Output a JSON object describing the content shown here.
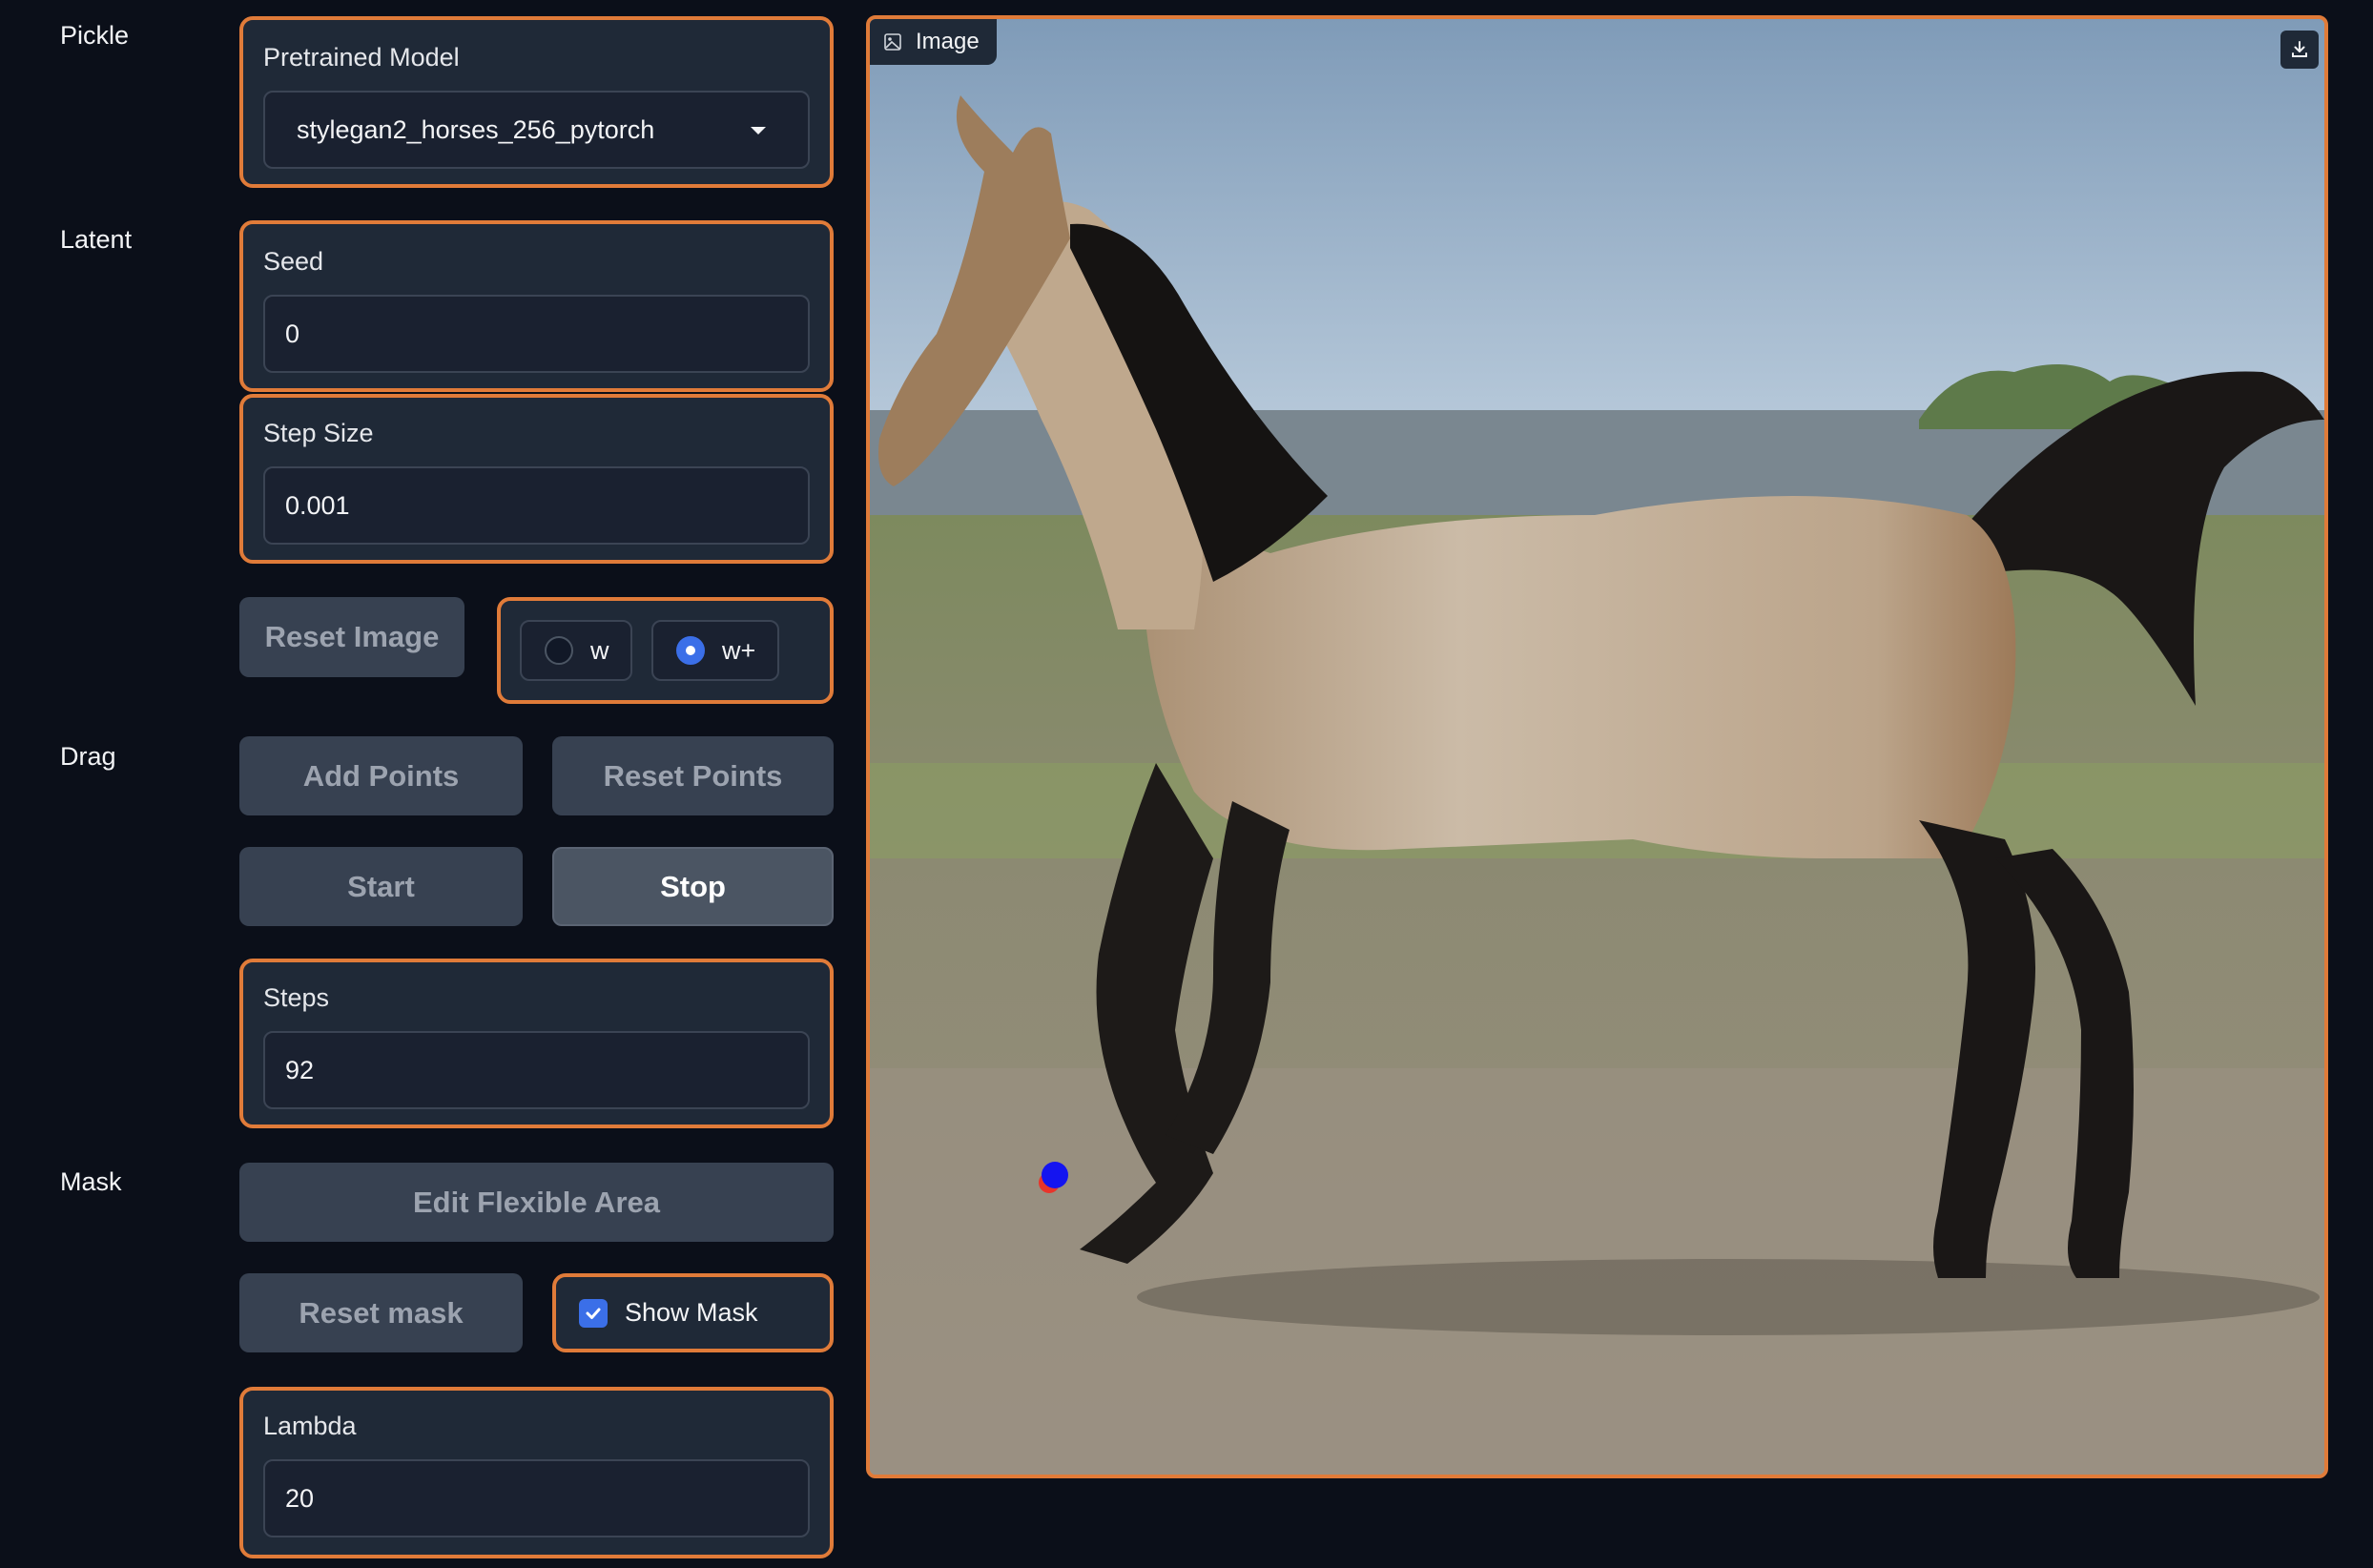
{
  "sections": {
    "pickle": "Pickle",
    "latent": "Latent",
    "drag": "Drag",
    "mask": "Mask"
  },
  "pretrained_model": {
    "label": "Pretrained Model",
    "value": "stylegan2_horses_256_pytorch"
  },
  "seed": {
    "label": "Seed",
    "value": "0"
  },
  "step_size": {
    "label": "Step Size",
    "value": "0.001"
  },
  "reset_image_label": "Reset Image",
  "latent_space": {
    "options": [
      "w",
      "w+"
    ],
    "selected": "w+"
  },
  "drag": {
    "add_points_label": "Add Points",
    "reset_points_label": "Reset Points",
    "start_label": "Start",
    "stop_label": "Stop"
  },
  "steps": {
    "label": "Steps",
    "value": "92"
  },
  "mask": {
    "edit_flexible_area_label": "Edit Flexible Area",
    "reset_mask_label": "Reset mask",
    "show_mask_label": "Show Mask",
    "show_mask_checked": true
  },
  "lambda": {
    "label": "Lambda",
    "value": "20"
  },
  "image_panel": {
    "title": "Image",
    "icons": [
      "image-icon",
      "download-icon"
    ]
  },
  "colors": {
    "accent_border": "#e07b39",
    "background": "#0b0f19",
    "block_bg": "#1f2937",
    "checked": "#3b6fe8"
  }
}
